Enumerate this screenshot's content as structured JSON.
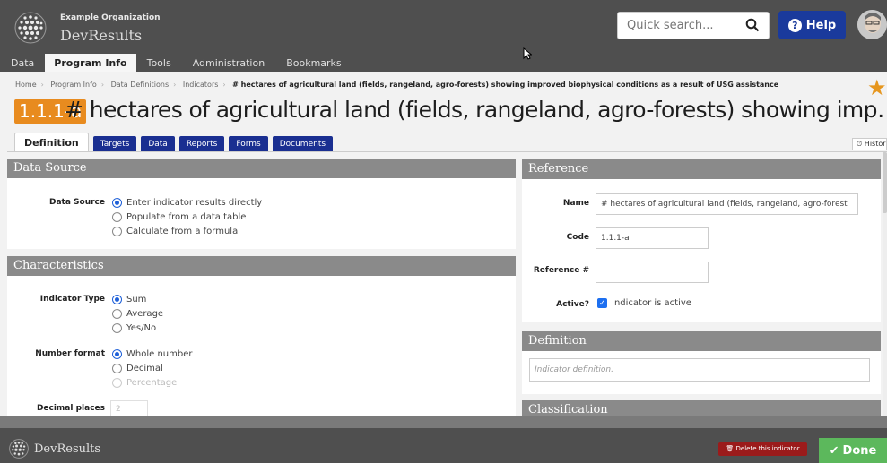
{
  "header": {
    "org_small": "Example Organization",
    "app_name": "DevResults",
    "search_placeholder": "Quick search...",
    "help_label": "Help"
  },
  "nav": [
    {
      "label": "Data"
    },
    {
      "label": "Program Info",
      "active": true
    },
    {
      "label": "Tools"
    },
    {
      "label": "Administration"
    },
    {
      "label": "Bookmarks"
    }
  ],
  "breadcrumb": {
    "items": [
      "Home",
      "Program Info",
      "Data Definitions",
      "Indicators"
    ],
    "current": "# hectares of agricultural land (fields, rangeland, agro-forests) showing improved biophysical conditions as a result of USG assistance"
  },
  "title": {
    "code": "1.1.1-a",
    "text": "# hectares of agricultural land (fields, rangeland, agro-forests) showing imp…"
  },
  "tabs": [
    {
      "label": "Definition",
      "active": true
    },
    {
      "label": "Targets"
    },
    {
      "label": "Data"
    },
    {
      "label": "Reports"
    },
    {
      "label": "Forms"
    },
    {
      "label": "Documents"
    }
  ],
  "history_label": "Histor",
  "data_source": {
    "heading": "Data Source",
    "label": "Data Source",
    "options": [
      {
        "label": "Enter indicator results directly",
        "selected": true
      },
      {
        "label": "Populate from a data table",
        "selected": false
      },
      {
        "label": "Calculate from a formula",
        "selected": false
      }
    ]
  },
  "characteristics": {
    "heading": "Characteristics",
    "indicator_type_label": "Indicator Type",
    "indicator_type_options": [
      {
        "label": "Sum",
        "selected": true
      },
      {
        "label": "Average",
        "selected": false
      },
      {
        "label": "Yes/No",
        "selected": false
      }
    ],
    "number_format_label": "Number format",
    "number_format_options": [
      {
        "label": "Whole number",
        "selected": true
      },
      {
        "label": "Decimal",
        "selected": false
      },
      {
        "label": "Percentage",
        "selected": false,
        "disabled": true
      }
    ],
    "decimal_places_label": "Decimal places",
    "decimal_places_value": "2"
  },
  "reference": {
    "heading": "Reference",
    "name_label": "Name",
    "name_value": "# hectares of agricultural land (fields, rangeland, agro-forest",
    "code_label": "Code",
    "code_value": "1.1.1-a",
    "ref_label": "Reference #",
    "ref_value": "",
    "active_label": "Active?",
    "active_text": "Indicator is active"
  },
  "definition": {
    "heading": "Definition",
    "placeholder": "Indicator definition."
  },
  "classification": {
    "heading": "Classification"
  },
  "footer": {
    "logo_text": "DevResults",
    "delete_label": "Delete this indicator",
    "done_label": "Done"
  },
  "colors": {
    "header_bg": "#4f4f4f",
    "tab_blue": "#1a2f91",
    "badge_orange": "#e88b1f",
    "done_green": "#5cb85c",
    "delete_red": "#9b1b1b"
  }
}
